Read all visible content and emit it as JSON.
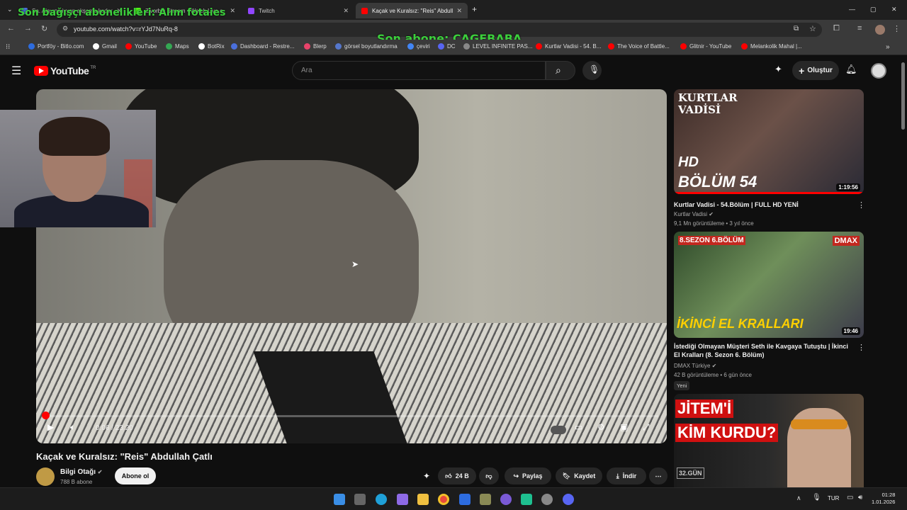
{
  "browser": {
    "tabs": [
      {
        "title": "Sa. Alayına iyyan akşama kadar"
      },
      {
        "title": "Zivorbin Stream - Watch Live o"
      },
      {
        "title": "Twitch"
      },
      {
        "title": "Kaçak ve Kuralsız: \"Reis\" Abdull"
      }
    ],
    "url": "youtube.com/watch?v=rYJd7NuRq-8",
    "bookmarks": [
      {
        "label": "Portföy - Bitlo.com",
        "color": "#2d6cdf"
      },
      {
        "label": "Gmail",
        "color": "#ffffff"
      },
      {
        "label": "YouTube",
        "color": "#ff0000"
      },
      {
        "label": "Maps",
        "color": "#34a853"
      },
      {
        "label": "BotRix",
        "color": "#ffffff"
      },
      {
        "label": "Dashboard - Restre...",
        "color": "#4a6fdc"
      },
      {
        "label": "Blerp",
        "color": "#e8436a"
      },
      {
        "label": "görsel boyutlandırma",
        "color": "#5577cc"
      },
      {
        "label": "çeviri",
        "color": "#4285f4"
      },
      {
        "label": "DC",
        "color": "#5865f2"
      },
      {
        "label": "LEVEL INFINITE PAS...",
        "color": "#888888"
      },
      {
        "label": "Kurtlar Vadisi - 54. B...",
        "color": "#ff0000"
      },
      {
        "label": "The Voice of Battle...",
        "color": "#ff0000"
      },
      {
        "label": "Glitnir - YouTube",
        "color": "#ff0000"
      },
      {
        "label": "Melankolik Mahal |...",
        "color": "#ff0000"
      }
    ]
  },
  "overlay": {
    "donation": "Son bağışçı abonelikleri: Alım fotaies",
    "subscriber": "Son abone: CAGEBABA"
  },
  "youtube": {
    "logo_text": "YouTube",
    "logo_region": "TR",
    "search_placeholder": "Ara",
    "create_label": "Oluştur"
  },
  "player": {
    "time": "0:06 / 23:20",
    "progress": 0.004
  },
  "video": {
    "title": "Kaçak ve Kuralsız: \"Reis\" Abdullah Çatlı",
    "channel": "Bilgi Otağı",
    "subscribers": "788 B abone",
    "subscribe_label": "Abone ol",
    "likes": "24 B",
    "share_label": "Paylaş",
    "save_label": "Kaydet",
    "download_label": "İndir"
  },
  "sidebar": [
    {
      "thumb_text_top": "KURTLAR VADİSİ",
      "thumb_text_hd": "HD",
      "thumb_text_main": "BÖLÜM 54",
      "duration": "1:19:56",
      "title": "Kurtlar Vadisi - 54.Bölüm | FULL HD YENİ",
      "channel": "Kurtlar Vadisi",
      "meta": "9,1 Mn görüntüleme • 3 yıl önce"
    },
    {
      "thumb_text_top": "8.SEZON 6.BÖLÜM",
      "thumb_text_hd": "DMAX",
      "thumb_text_main": "İKİNCİ EL KRALLARI",
      "duration": "19:46",
      "title": "İstediği Olmayan Müşteri Seth ile Kavgaya Tutuştu | İkinci El Kralları (8. Sezon 6. Bölüm)",
      "channel": "DMAX Türkiye",
      "meta": "42 B görüntüleme • 6 gün önce",
      "badge": "Yeni"
    },
    {
      "thumb_text_top": "JİTEM'İ",
      "thumb_text_main": "KİM KURDU?",
      "thumb_text_hd": "32.GÜN"
    }
  ],
  "system": {
    "lang": "TUR",
    "time": "01:28",
    "date": "1.01.2026"
  }
}
